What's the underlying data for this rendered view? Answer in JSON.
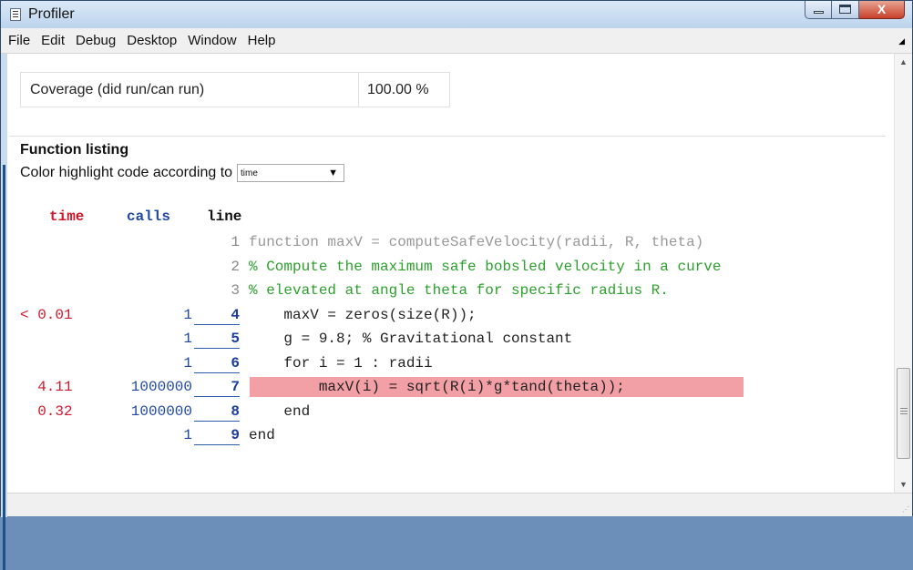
{
  "window": {
    "title": "Profiler",
    "close_glyph": "X"
  },
  "menu": [
    "File",
    "Edit",
    "Debug",
    "Desktop",
    "Window",
    "Help"
  ],
  "coverage": {
    "label": "Coverage (did run/can run)",
    "value": "100.00 %"
  },
  "function_listing": {
    "title": "Function listing",
    "highlight_label": "Color highlight code according to",
    "highlight_value": "time"
  },
  "columns": {
    "time": "time",
    "calls": "calls",
    "line": "line"
  },
  "lines": [
    {
      "time": "",
      "calls": "",
      "line": "1",
      "code": "function maxV = computeSafeVelocity(radii, R, theta)",
      "style": "grey",
      "linked": false,
      "highlight": false
    },
    {
      "time": "",
      "calls": "",
      "line": "2",
      "code": "% Compute the maximum safe bobsled velocity in a curve",
      "style": "green",
      "linked": false,
      "highlight": false
    },
    {
      "time": "",
      "calls": "",
      "line": "3",
      "code": "% elevated at angle theta for specific radius R.",
      "style": "green",
      "linked": false,
      "highlight": false
    },
    {
      "time": "< 0.01",
      "calls": "1",
      "line": "4",
      "code": "    maxV = zeros(size(R));",
      "style": "",
      "linked": true,
      "highlight": false
    },
    {
      "time": "",
      "calls": "1",
      "line": "5",
      "code": "    g = 9.8; % Gravitational constant",
      "style": "",
      "linked": true,
      "highlight": false
    },
    {
      "time": "",
      "calls": "1",
      "line": "6",
      "code": "    for i = 1 : radii",
      "style": "",
      "linked": true,
      "highlight": false
    },
    {
      "time": "  4.11",
      "calls": "1000000",
      "line": "7",
      "code": "        maxV(i) = sqrt(R(i)*g*tand(theta));",
      "style": "",
      "linked": true,
      "highlight": true
    },
    {
      "time": "  0.32",
      "calls": "1000000",
      "line": "8",
      "code": "    end",
      "style": "",
      "linked": true,
      "highlight": false
    },
    {
      "time": "",
      "calls": "1",
      "line": "9",
      "code": "end",
      "style": "",
      "linked": true,
      "highlight": false
    }
  ]
}
